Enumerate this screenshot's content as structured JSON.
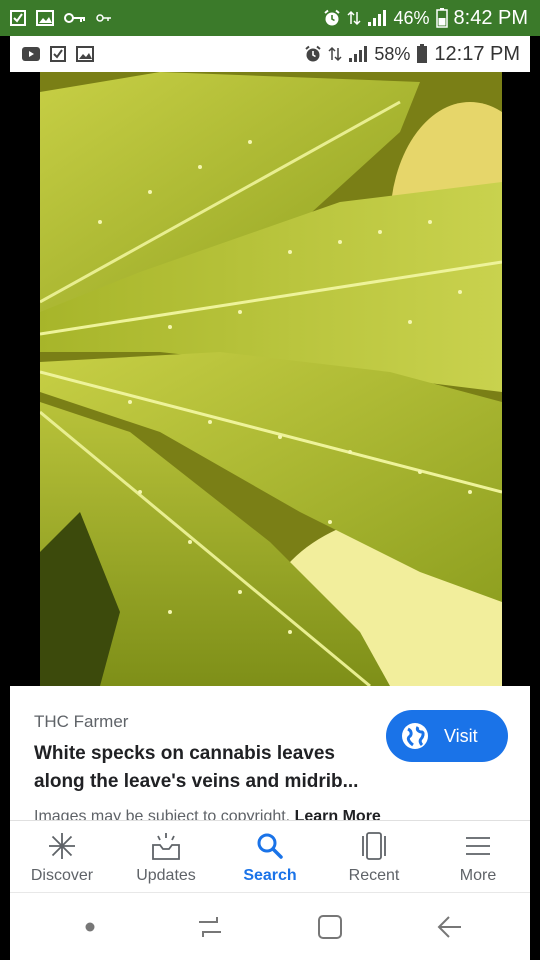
{
  "outer_status": {
    "battery": "46%",
    "time": "8:42 PM"
  },
  "inner_status": {
    "battery": "58%",
    "time": "12:17 PM"
  },
  "result": {
    "source": "THC Farmer",
    "title_line1": "White specks on cannabis leaves",
    "title_line2": "along the leave's veins and midrib...",
    "visit_label": "Visit",
    "copyright_text": "Images may be subject to copyright.",
    "learn_more": "Learn More"
  },
  "nav": {
    "items": [
      {
        "label": "Discover",
        "icon": "asterisk-icon"
      },
      {
        "label": "Updates",
        "icon": "inbox-icon"
      },
      {
        "label": "Search",
        "icon": "search-icon"
      },
      {
        "label": "Recent",
        "icon": "recent-cards-icon"
      },
      {
        "label": "More",
        "icon": "menu-icon"
      }
    ],
    "active": "Search"
  },
  "colors": {
    "outer_status_bg": "#3b7a2a",
    "accent": "#1a73e8"
  }
}
